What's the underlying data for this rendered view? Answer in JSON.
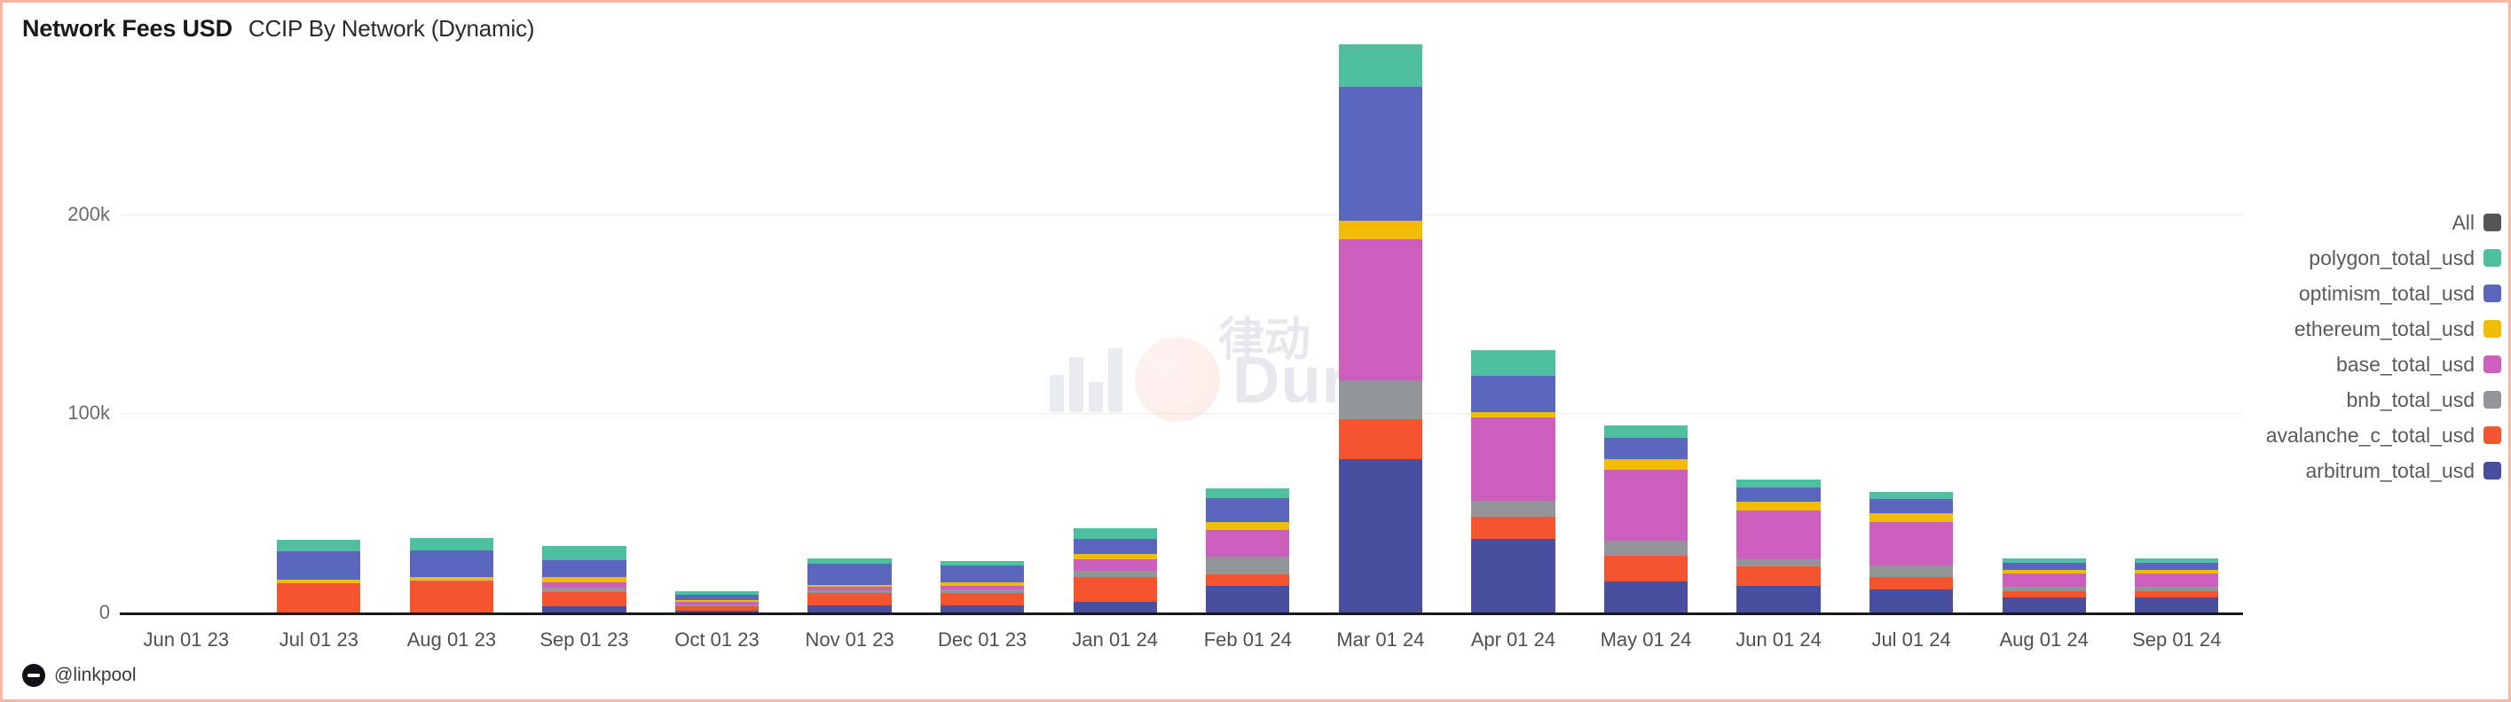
{
  "header": {
    "title": "Network Fees USD",
    "subtitle": "CCIP By Network (Dynamic)"
  },
  "footer": {
    "handle": "@linkpool",
    "logo_icon": "dune-logo-icon"
  },
  "watermark": {
    "text": "Dune",
    "cn_text": "律动",
    "bars_icon": "bar-chart-icon"
  },
  "legend": {
    "position": "right",
    "items": [
      {
        "label": "All",
        "color": "#555555"
      },
      {
        "label": "polygon_total_usd",
        "color": "#4ec0a0"
      },
      {
        "label": "optimism_total_usd",
        "color": "#5b67bd"
      },
      {
        "label": "ethereum_total_usd",
        "color": "#f2bb05"
      },
      {
        "label": "base_total_usd",
        "color": "#cc5fbe"
      },
      {
        "label": "bnb_total_usd",
        "color": "#939598"
      },
      {
        "label": "avalanche_c_total_usd",
        "color": "#f4552f"
      },
      {
        "label": "arbitrum_total_usd",
        "color": "#4a4e9e"
      }
    ]
  },
  "chart_data": {
    "type": "bar",
    "stacked": true,
    "title": "Network Fees USD",
    "subtitle": "CCIP By Network (Dynamic)",
    "xlabel": "",
    "ylabel": "",
    "ylim": [
      0,
      260000
    ],
    "grid": true,
    "yticks": [
      {
        "value": 0,
        "label": "0"
      },
      {
        "value": 100000,
        "label": "100k"
      },
      {
        "value": 200000,
        "label": "200k"
      }
    ],
    "categories": [
      "Jun 01 23",
      "Jul 01 23",
      "Aug 01 23",
      "Sep 01 23",
      "Oct 01 23",
      "Nov 01 23",
      "Dec 01 23",
      "Jan 01 24",
      "Feb 01 24",
      "Mar 01 24",
      "Apr 01 24",
      "May 01 24",
      "Jun 01 24",
      "Jul 01 24",
      "Aug 01 24",
      "Sep 01 24"
    ],
    "series": [
      {
        "name": "arbitrum_total_usd",
        "color": "#4a4e9e",
        "values": [
          0,
          0,
          0,
          3000,
          1000,
          3500,
          3500,
          5200,
          13500,
          77000,
          37000,
          15500,
          13500,
          11500,
          7500,
          7500
        ]
      },
      {
        "name": "avalanche_c_total_usd",
        "color": "#f4552f",
        "values": [
          0,
          14500,
          15500,
          7200,
          2200,
          6500,
          6500,
          12500,
          5500,
          20000,
          11000,
          13000,
          9500,
          6500,
          3000,
          3000
        ]
      },
      {
        "name": "bnb_total_usd",
        "color": "#939598",
        "values": [
          0,
          0,
          0,
          2300,
          800,
          1200,
          1500,
          3200,
          9000,
          19500,
          8000,
          7500,
          3500,
          5500,
          2500,
          2500
        ]
      },
      {
        "name": "base_total_usd",
        "color": "#cc5fbe",
        "values": [
          0,
          0,
          500,
          2800,
          1500,
          1500,
          2000,
          5700,
          13500,
          71000,
          42000,
          35500,
          24500,
          22000,
          6500,
          6500
        ]
      },
      {
        "name": "ethereum_total_usd",
        "color": "#f2bb05",
        "values": [
          0,
          1800,
          1800,
          2600,
          900,
          1300,
          1500,
          2700,
          4000,
          9500,
          2500,
          5500,
          4500,
          4500,
          2000,
          2000
        ]
      },
      {
        "name": "optimism_total_usd",
        "color": "#5b67bd",
        "values": [
          0,
          14500,
          13500,
          8200,
          2500,
          10500,
          8500,
          7500,
          12000,
          67000,
          18500,
          10500,
          7500,
          7000,
          3500,
          3500
        ]
      },
      {
        "name": "polygon_total_usd",
        "color": "#4ec0a0",
        "values": [
          0,
          5500,
          6200,
          7500,
          2000,
          2500,
          2500,
          5700,
          5000,
          21500,
          13000,
          6500,
          4000,
          3500,
          2000,
          2000
        ]
      }
    ],
    "totals": [
      0,
      36300,
      37500,
      33600,
      10900,
      27000,
      26000,
      42500,
      62500,
      285500,
      132000,
      94000,
      67000,
      60500,
      27000,
      27000
    ]
  }
}
